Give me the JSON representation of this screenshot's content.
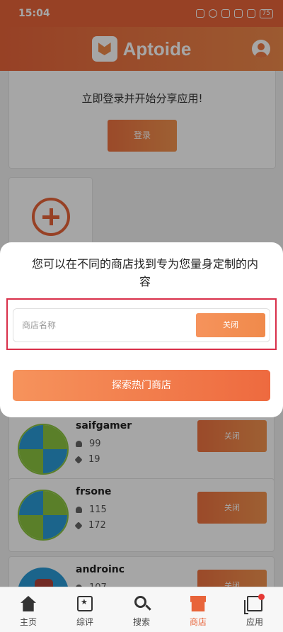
{
  "status_bar": {
    "time": "15:04",
    "battery": "75"
  },
  "app_bar": {
    "brand": "Aptoide"
  },
  "login_card": {
    "prompt": "立即登录并开始分享应用!",
    "login_label": "登录"
  },
  "stores": [
    {
      "name": "saifgamer",
      "users": "99",
      "apps": "19",
      "close_label": "关闭"
    },
    {
      "name": "frsone",
      "users": "115",
      "apps": "172",
      "close_label": "关闭"
    },
    {
      "name": "androinc",
      "users": "107",
      "close_label": "关闭"
    }
  ],
  "dialog": {
    "title": "您可以在不同的商店找到专为您量身定制的内容",
    "search_placeholder": "商店名称",
    "close_label": "关闭",
    "explore_label": "探索热门商店"
  },
  "bottom_nav": [
    {
      "label": "主页",
      "icon": "home-icon"
    },
    {
      "label": "综评",
      "icon": "calendar-star-icon"
    },
    {
      "label": "搜索",
      "icon": "search-icon"
    },
    {
      "label": "商店",
      "icon": "store-icon",
      "active": true
    },
    {
      "label": "应用",
      "icon": "apps-icon",
      "badge": true
    }
  ],
  "colors": {
    "accent": "#e8643a",
    "highlight": "#d9304a"
  }
}
